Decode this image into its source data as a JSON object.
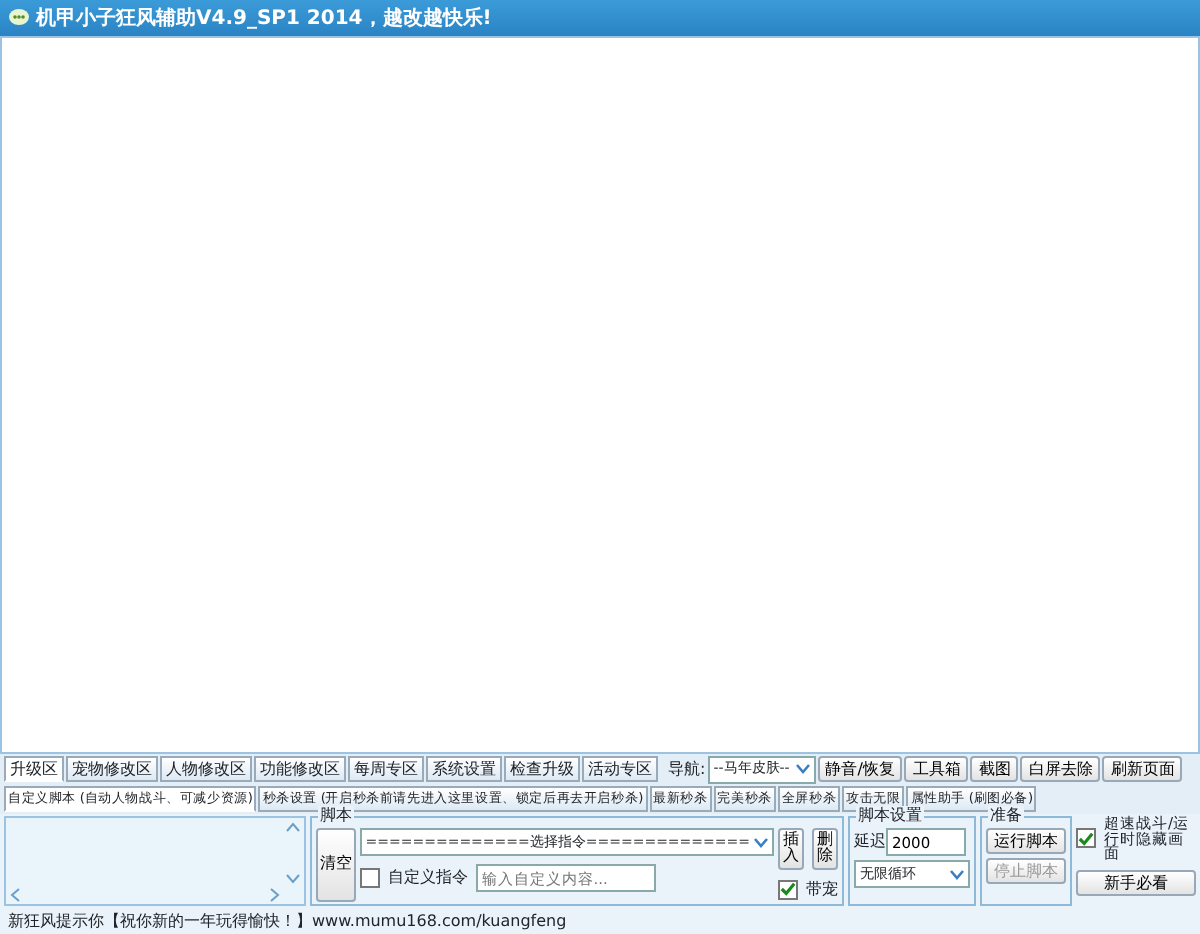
{
  "window": {
    "title": "机甲小子狂风辅助V4.9_SP1  2014，越改越快乐!"
  },
  "tabs": [
    {
      "label": "升级区",
      "selected": true
    },
    {
      "label": "宠物修改区",
      "selected": false
    },
    {
      "label": "人物修改区",
      "selected": false
    },
    {
      "label": "功能修改区",
      "selected": false
    },
    {
      "label": "每周专区",
      "selected": false
    },
    {
      "label": "系统设置",
      "selected": false
    },
    {
      "label": "检查升级",
      "selected": false
    },
    {
      "label": "活动专区",
      "selected": false
    }
  ],
  "nav": {
    "label": "导航:",
    "value": "--马年皮肤--"
  },
  "toolbar": [
    "静音/恢复",
    "工具箱",
    "截图",
    "白屏去除",
    "刷新页面"
  ],
  "subtabs": [
    {
      "label": "自定义脚本 (自动人物战斗、可减少资源)",
      "selected": true
    },
    {
      "label": "秒杀设置 (开启秒杀前请先进入这里设置、锁定后再去开启秒杀)",
      "selected": false
    },
    {
      "label": "最新秒杀",
      "selected": false
    },
    {
      "label": "完美秒杀",
      "selected": false
    },
    {
      "label": "全屏秒杀",
      "selected": false
    },
    {
      "label": "攻击无限",
      "selected": false
    },
    {
      "label": "属性助手 (刷图必备)",
      "selected": false
    }
  ],
  "script": {
    "title": "脚本",
    "clear": "清空",
    "command": "==============选择指令==============",
    "custom_checkbox": {
      "label": "自定义指令",
      "checked": false
    },
    "custom_placeholder": "输入自定义内容...",
    "insert": "插入",
    "delete": "删除",
    "pet_checkbox": {
      "label": "带宠",
      "checked": true
    }
  },
  "script_settings": {
    "title": "脚本设置",
    "delay_label": "延迟",
    "delay": "2000",
    "loop": "无限循环"
  },
  "prepare": {
    "title": "准备",
    "run": "运行脚本",
    "stop": {
      "label": "停止脚本",
      "disabled": true
    }
  },
  "fast_checkbox": {
    "label": "超速战斗/运行时隐藏画面",
    "checked": true
  },
  "guide_button": "新手必看",
  "status_bar": "新狂风提示你【祝你新的一年玩得愉快！】www.mumu168.com/kuangfeng"
}
